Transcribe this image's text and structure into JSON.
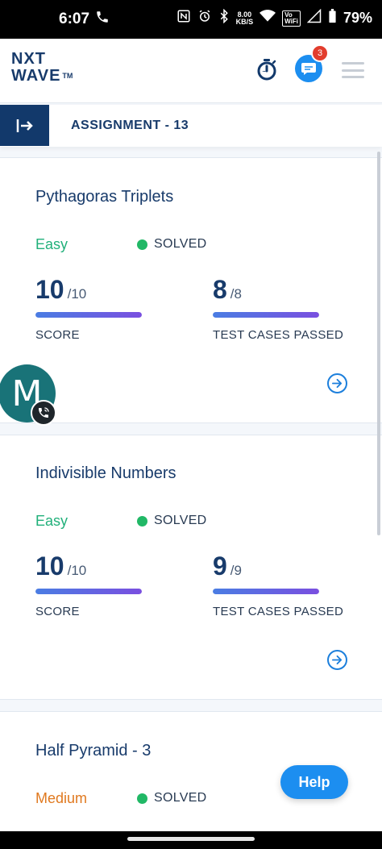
{
  "status_bar": {
    "time": "6:07",
    "speed": [
      "8.00",
      "KB/S"
    ],
    "vowifi": [
      "Vo",
      "WiFi"
    ],
    "battery": "79%"
  },
  "app_bar": {
    "logo_line1": "NXT",
    "logo_line2": "WAVE",
    "logo_tm": "TM",
    "notification_count": "3",
    "icons": [
      "timer-icon",
      "chat-icon",
      "menu-icon"
    ]
  },
  "sub_header": {
    "title": "ASSIGNMENT - 13",
    "toggle_icon": "sidebar-expand-icon"
  },
  "problems": [
    {
      "name": "Pythagoras Triplets",
      "difficulty": "Easy",
      "difficulty_color": "#21b07a",
      "status": "SOLVED",
      "score": {
        "value": "10",
        "total": "/10",
        "label": "SCORE",
        "fraction": 1.0
      },
      "tests": {
        "value": "8",
        "total": "/8",
        "label": "TEST CASES PASSED",
        "fraction": 1.0
      }
    },
    {
      "name": "Indivisible Numbers",
      "difficulty": "Easy",
      "difficulty_color": "#21b07a",
      "status": "SOLVED",
      "score": {
        "value": "10",
        "total": "/10",
        "label": "SCORE",
        "fraction": 1.0
      },
      "tests": {
        "value": "9",
        "total": "/9",
        "label": "TEST CASES PASSED",
        "fraction": 1.0
      }
    },
    {
      "name": "Half Pyramid - 3",
      "difficulty": "Medium",
      "difficulty_color": "#e0791f",
      "status": "SOLVED"
    }
  ],
  "floating": {
    "avatar_letter": "M",
    "help_label": "Help"
  },
  "colors": {
    "brand_navy": "#12396b",
    "accent_blue": "#1c8ef0",
    "solved_green": "#21b866"
  }
}
